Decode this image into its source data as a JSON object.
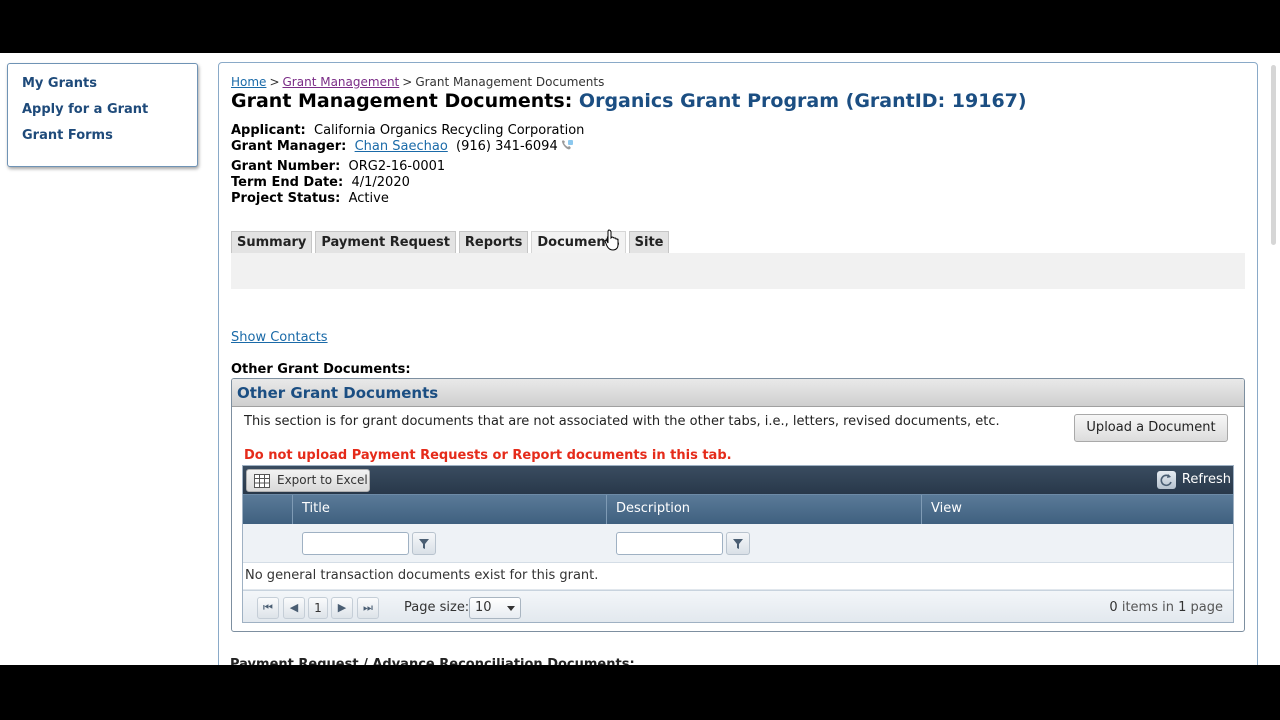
{
  "leftnav": {
    "items": [
      {
        "label": "My Grants"
      },
      {
        "label": "Apply for a Grant"
      },
      {
        "label": "Grant Forms"
      }
    ]
  },
  "breadcrumb": {
    "home": "Home",
    "sep1": ">",
    "grant_management": "Grant Management",
    "sep2": ">",
    "current": "Grant Management Documents"
  },
  "title": {
    "prefix": "Grant Management Documents:",
    "program": "Organics Grant Program (GrantID: 19167)"
  },
  "info": {
    "applicant_label": "Applicant:",
    "applicant_value": "California Organics Recycling Corporation",
    "manager_label": "Grant Manager:",
    "manager_name": "Chan Saechao",
    "manager_phone": "(916) 341-6094",
    "grant_number_label": "Grant Number:",
    "grant_number_value": "ORG2-16-0001",
    "term_end_label": "Term End Date:",
    "term_end_value": "4/1/2020",
    "status_label": "Project Status:",
    "status_value": "Active"
  },
  "tabs": [
    {
      "label": "Summary"
    },
    {
      "label": "Payment Request"
    },
    {
      "label": "Reports"
    },
    {
      "label": "Documents"
    },
    {
      "label": "Site"
    }
  ],
  "show_contacts": "Show Contacts",
  "other_docs_label": "Other Grant Documents:",
  "docbox": {
    "title": "Other Grant Documents",
    "description": "This section is for grant documents that are not associated with the other tabs, i.e., letters, revised documents, etc.",
    "warning": "Do not upload Payment Requests or Report documents in this tab.",
    "upload_button": "Upload a Document"
  },
  "grid": {
    "export_label": "Export to Excel",
    "refresh_label": "Refresh",
    "columns": [
      "Title",
      "Description",
      "View"
    ],
    "empty_message": "No general transaction documents exist for this grant.",
    "current_page": "1",
    "page_size_label": "Page size:",
    "page_size_value": "10",
    "items_count": "0",
    "items_in_text": "items in",
    "pages_count": "1",
    "page_word": "page"
  },
  "next_section_title": "Payment Request / Advance Reconciliation Documents:",
  "colors": {
    "accent_blue": "#1b4e82",
    "link_blue": "#1a6aa8",
    "warning_red": "#e52b1a",
    "grid_header": "#4a6b8a"
  }
}
